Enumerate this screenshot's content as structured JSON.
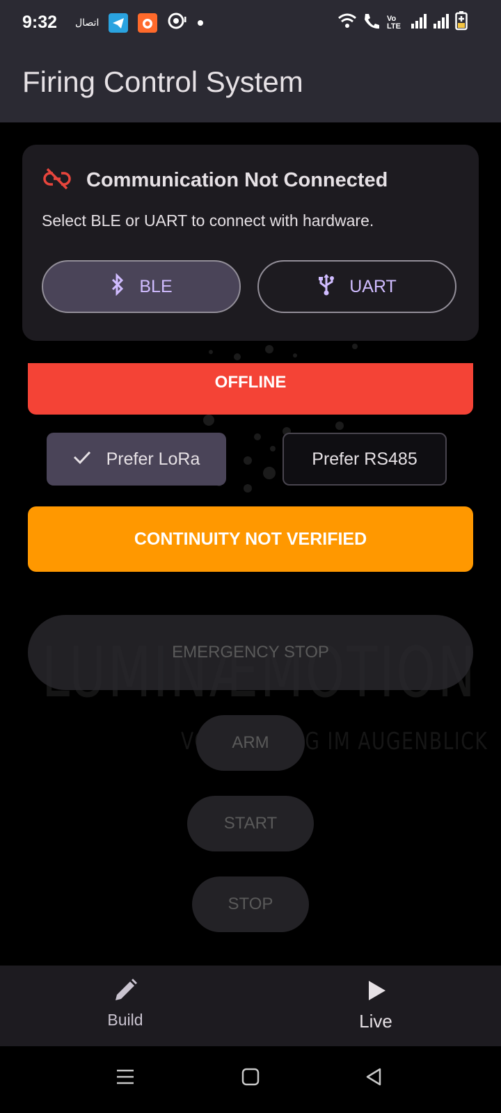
{
  "status_bar": {
    "time": "9:32",
    "icons_left": [
      "carrier-icon",
      "telegram-icon",
      "app-icon",
      "podcast-icon",
      "dot-icon"
    ],
    "icons_right": [
      "wifi-icon",
      "volte-call-icon",
      "signal-icon",
      "signal-icon",
      "battery-icon"
    ],
    "volte_label": "Vo LTE",
    "carrier_label": "اتصال"
  },
  "app_bar": {
    "title": "Firing Control System"
  },
  "communication": {
    "title": "Communication Not Connected",
    "subtitle": "Select BLE or UART to connect with hardware.",
    "ble_label": "BLE",
    "uart_label": "UART",
    "status_icon": "link-off-icon"
  },
  "status": {
    "offline_label": "OFFLINE",
    "offline_color": "#f44336"
  },
  "preference": {
    "lora_label": "Prefer LoRa",
    "rs485_label": "Prefer RS485",
    "selected": "lora"
  },
  "continuity": {
    "label": "CONTINUITY NOT VERIFIED",
    "color": "#ff9800"
  },
  "watermark": {
    "main": "LUMINÆMOTION",
    "sub": "VOLLENDUNG IM AUGENBLICK"
  },
  "controls": {
    "emergency_stop": "EMERGENCY STOP",
    "arm": "ARM",
    "start": "START",
    "stop": "STOP"
  },
  "bottom_nav": {
    "items": [
      {
        "label": "Build",
        "icon": "pencil-icon"
      },
      {
        "label": "Live",
        "icon": "play-icon"
      }
    ]
  },
  "system_nav": {
    "icons": [
      "menu-icon",
      "home-icon",
      "back-icon"
    ]
  }
}
